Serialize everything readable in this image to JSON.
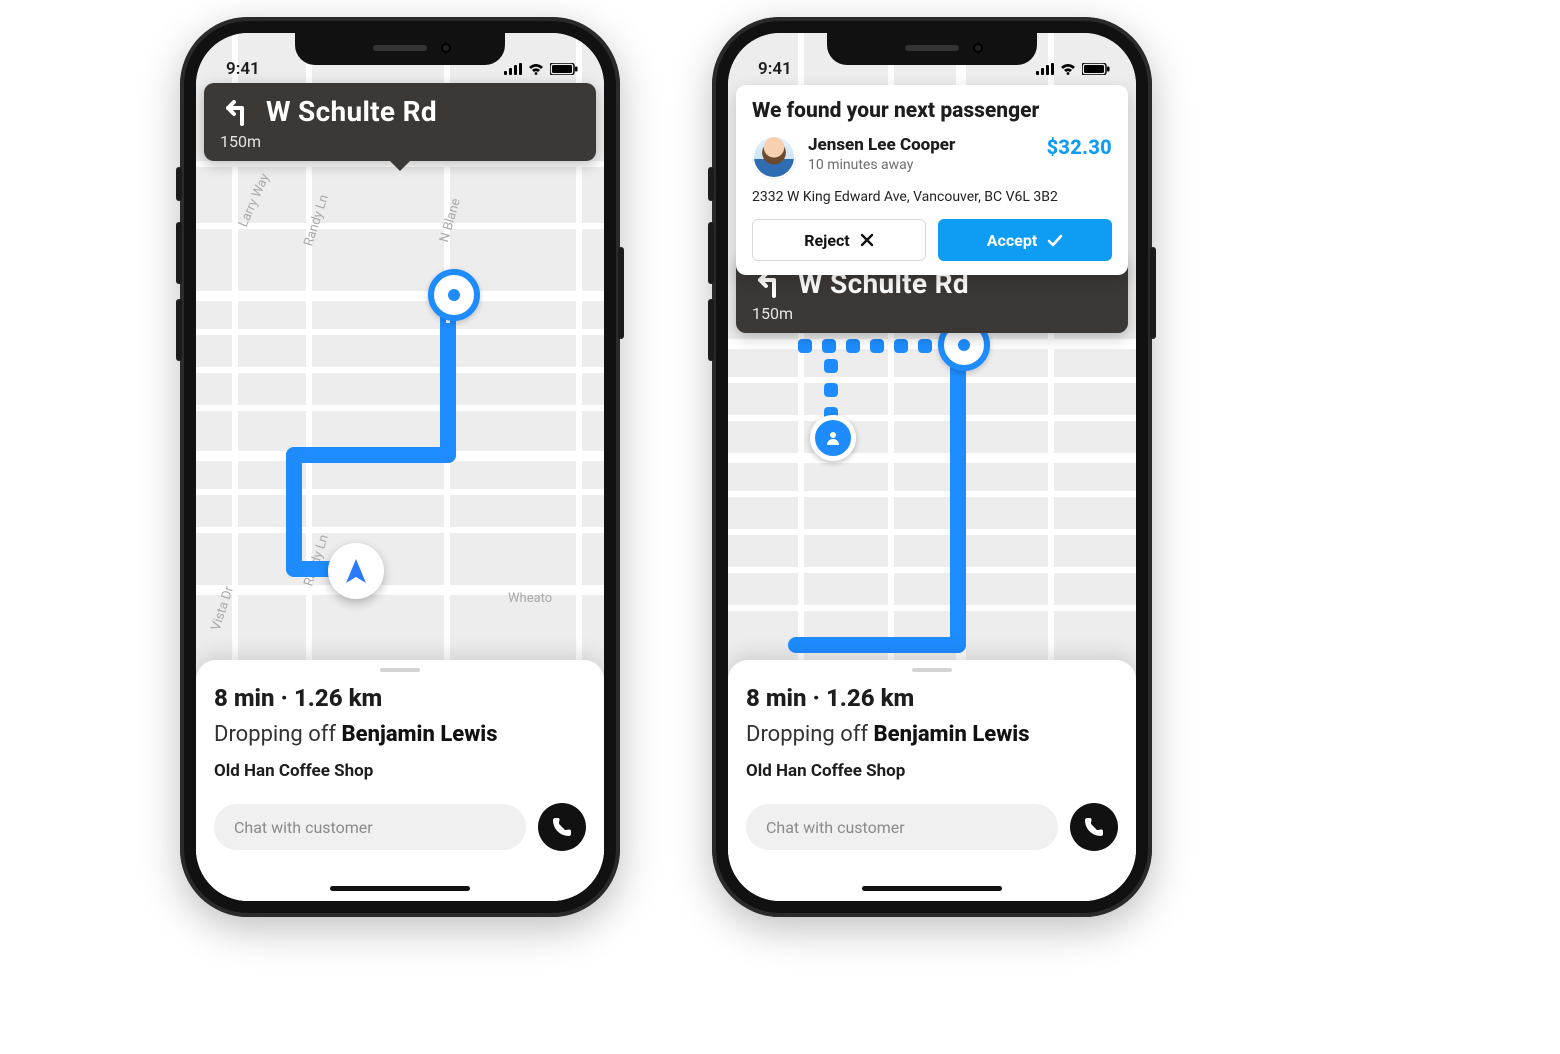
{
  "status": {
    "time": "9:41"
  },
  "turn": {
    "street": "W Schulte Rd",
    "distance": "150m"
  },
  "sheet": {
    "eta": "8 min · 1.26 km",
    "drop_prefix": "Dropping off ",
    "drop_name": "Benjamin Lewis",
    "poi": "Old Han Coffee Shop",
    "chat_placeholder": "Chat with customer"
  },
  "map": {
    "labels": {
      "larry": "Larry Way",
      "randy": "Randy Ln",
      "randy2": "Randy Ln",
      "blane": "N Blane",
      "vista": "Vista Dr",
      "wheaton": "Wheato"
    }
  },
  "notif": {
    "title": "We found your next passenger",
    "name": "Jensen Lee Cooper",
    "subtitle": "10 minutes away",
    "price": "$32.30",
    "address": "2332 W King Edward Ave, Vancouver, BC V6L 3B2",
    "reject": "Reject",
    "accept": "Accept"
  }
}
